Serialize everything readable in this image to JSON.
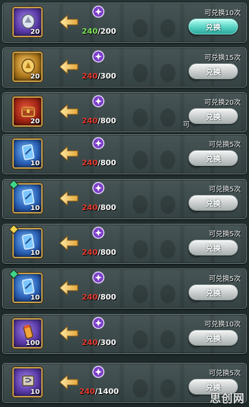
{
  "colors": {
    "cost_ok": "#7ee35a",
    "cost_low": "#e4392e",
    "button_active": "#5fd6c8",
    "button_inactive": "#c9cdcd",
    "frame_gold": "#c9a14a"
  },
  "rows": [
    {
      "item_icon": "silver-rune-icon",
      "frame": "purple",
      "quantity": "20",
      "gem": "",
      "cost_icon": "purple-currency-icon",
      "have": "240",
      "need": "/200",
      "enough": true,
      "limit": "可兑换10次",
      "button": "兑换",
      "button_active": true,
      "partial": ""
    },
    {
      "item_icon": "gold-rune-icon",
      "frame": "gold",
      "quantity": "20",
      "gem": "",
      "cost_icon": "purple-currency-icon",
      "have": "240",
      "need": "/300",
      "enough": false,
      "limit": "可兑换15次",
      "button": "兑换",
      "button_active": false,
      "partial": ""
    },
    {
      "item_icon": "treasure-chest-icon",
      "frame": "red",
      "quantity": "20",
      "gem": "",
      "cost_icon": "purple-currency-icon",
      "have": "240",
      "need": "/800",
      "enough": false,
      "limit": "可兑换20次",
      "button": "兑换",
      "button_active": false,
      "partial": "可"
    },
    {
      "item_icon": "blue-card-icon",
      "frame": "blue",
      "quantity": "10",
      "gem": "",
      "cost_icon": "purple-currency-icon",
      "have": "240",
      "need": "/800",
      "enough": false,
      "limit": "可兑换5次",
      "button": "兑换",
      "button_active": false,
      "partial": ""
    },
    {
      "item_icon": "blue-card-icon",
      "frame": "blue",
      "quantity": "10",
      "gem": "green",
      "cost_icon": "purple-currency-icon",
      "have": "240",
      "need": "/800",
      "enough": false,
      "limit": "可兑换5次",
      "button": "兑换",
      "button_active": false,
      "partial": ""
    },
    {
      "item_icon": "blue-card-icon",
      "frame": "blue",
      "quantity": "10",
      "gem": "yellow",
      "cost_icon": "purple-currency-icon",
      "have": "240",
      "need": "/800",
      "enough": false,
      "limit": "可兑换5次",
      "button": "兑换",
      "button_active": false,
      "partial": ""
    },
    {
      "item_icon": "blue-card-icon",
      "frame": "blue",
      "quantity": "10",
      "gem": "green",
      "cost_icon": "purple-currency-icon",
      "have": "240",
      "need": "/800",
      "enough": false,
      "limit": "可兑换5次",
      "button": "兑换",
      "button_active": false,
      "partial": ""
    },
    {
      "item_icon": "scroll-vial-icon",
      "frame": "purple",
      "quantity": "100",
      "gem": "",
      "cost_icon": "purple-currency-icon",
      "have": "240",
      "need": "/300",
      "enough": false,
      "limit": "可兑换10次",
      "button": "兑换",
      "button_active": false,
      "partial": ""
    },
    {
      "item_icon": "scroll-icon",
      "frame": "purple",
      "quantity": "10",
      "gem": "",
      "cost_icon": "purple-currency-icon",
      "have": "240",
      "need": "/1400",
      "enough": false,
      "limit": "可兑换5次",
      "button": "兑换",
      "button_active": false,
      "partial": ""
    }
  ],
  "watermark": "思创网"
}
